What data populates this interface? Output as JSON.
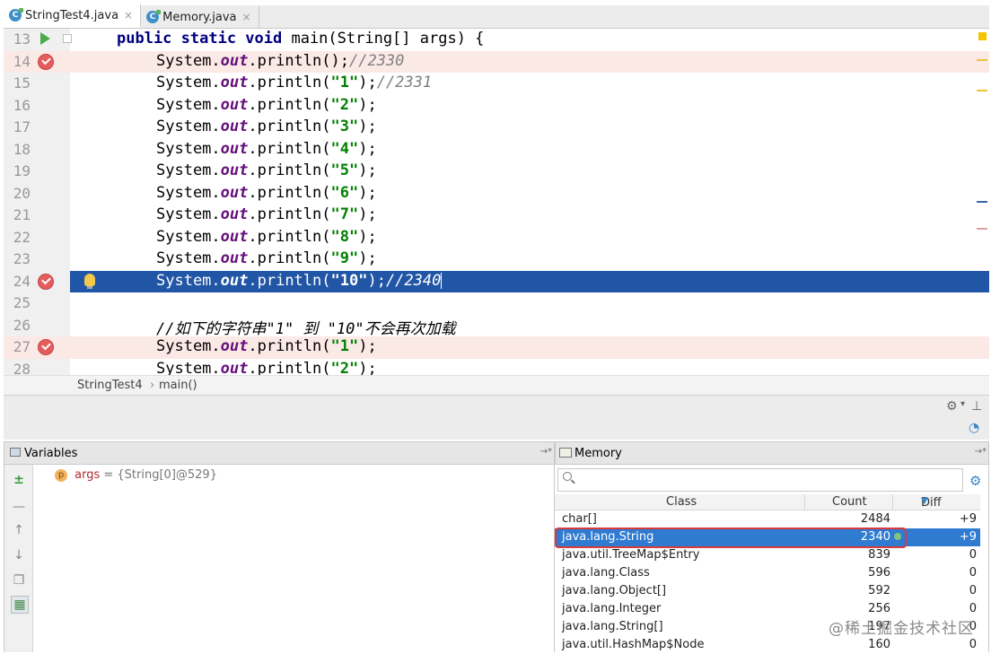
{
  "tabs": [
    {
      "label": "StringTest4.java",
      "close": "×"
    },
    {
      "label": "Memory.java",
      "close": "×"
    }
  ],
  "editor": {
    "lines": [
      {
        "num": "13",
        "pre": "",
        "kw": "public static void",
        "main": " main(String[] args) {",
        "arg": "",
        "post": "",
        "comment": ""
      },
      {
        "num": "14",
        "pre": "System.",
        "field": "out",
        "call": ".println();",
        "comment": "//2330"
      },
      {
        "num": "15",
        "pre": "System.",
        "field": "out",
        "call": ".println(",
        "arg": "\"1\"",
        "post": ");",
        "comment": "//2331"
      },
      {
        "num": "16",
        "pre": "System.",
        "field": "out",
        "call": ".println(",
        "arg": "\"2\"",
        "post": ");",
        "comment": ""
      },
      {
        "num": "17",
        "pre": "System.",
        "field": "out",
        "call": ".println(",
        "arg": "\"3\"",
        "post": ");",
        "comment": ""
      },
      {
        "num": "18",
        "pre": "System.",
        "field": "out",
        "call": ".println(",
        "arg": "\"4\"",
        "post": ");",
        "comment": ""
      },
      {
        "num": "19",
        "pre": "System.",
        "field": "out",
        "call": ".println(",
        "arg": "\"5\"",
        "post": ");",
        "comment": ""
      },
      {
        "num": "20",
        "pre": "System.",
        "field": "out",
        "call": ".println(",
        "arg": "\"6\"",
        "post": ");",
        "comment": ""
      },
      {
        "num": "21",
        "pre": "System.",
        "field": "out",
        "call": ".println(",
        "arg": "\"7\"",
        "post": ");",
        "comment": ""
      },
      {
        "num": "22",
        "pre": "System.",
        "field": "out",
        "call": ".println(",
        "arg": "\"8\"",
        "post": ");",
        "comment": ""
      },
      {
        "num": "23",
        "pre": "System.",
        "field": "out",
        "call": ".println(",
        "arg": "\"9\"",
        "post": ");",
        "comment": ""
      },
      {
        "num": "24",
        "pre": "System.",
        "field": "out",
        "call": ".println(",
        "arg": "\"10\"",
        "post": ");",
        "comment": "//2340"
      },
      {
        "num": "25",
        "pre": "",
        "comment": ""
      },
      {
        "num": "26",
        "pre": "",
        "comment": "//如下的字符串\"1\" 到 \"10\"不会再次加载"
      },
      {
        "num": "27",
        "pre": "System.",
        "field": "out",
        "call": ".println(",
        "arg": "\"1\"",
        "post": ");",
        "comment": ""
      },
      {
        "num": "28",
        "pre": "System.",
        "field": "out",
        "call": ".println(",
        "arg": "\"2\"",
        "post": ");",
        "comment": ""
      }
    ]
  },
  "breadcrumb": {
    "file": "StringTest4",
    "sep": "›",
    "method": "main()"
  },
  "variables": {
    "title": "Variables",
    "pin": "→*",
    "item_badge": "p",
    "item_name": "args",
    "item_value": " = {String[0]@529}"
  },
  "memory": {
    "title": "Memory",
    "pin": "→*",
    "columns": {
      "class": "Class",
      "count": "Count",
      "diff": "Diff"
    },
    "rows": [
      {
        "class": "char[]",
        "count": "2484",
        "diff": "+9"
      },
      {
        "class": "java.lang.String",
        "count": "2340",
        "diff": "+9"
      },
      {
        "class": "java.util.TreeMap$Entry",
        "count": "839",
        "diff": "0"
      },
      {
        "class": "java.lang.Class",
        "count": "596",
        "diff": "0"
      },
      {
        "class": "java.lang.Object[]",
        "count": "592",
        "diff": "0"
      },
      {
        "class": "java.lang.Integer",
        "count": "256",
        "diff": "0"
      },
      {
        "class": "java.lang.String[]",
        "count": "197",
        "diff": "0"
      },
      {
        "class": "java.util.HashMap$Node",
        "count": "160",
        "diff": "0"
      }
    ]
  },
  "watermark": "@稀土掘金技术社区",
  "colors": {
    "current_line": "#2155a5",
    "breakpoint_line": "#fbe9e6",
    "selected_row": "#2f7bd2",
    "highlight_box": "#d93a3a"
  }
}
